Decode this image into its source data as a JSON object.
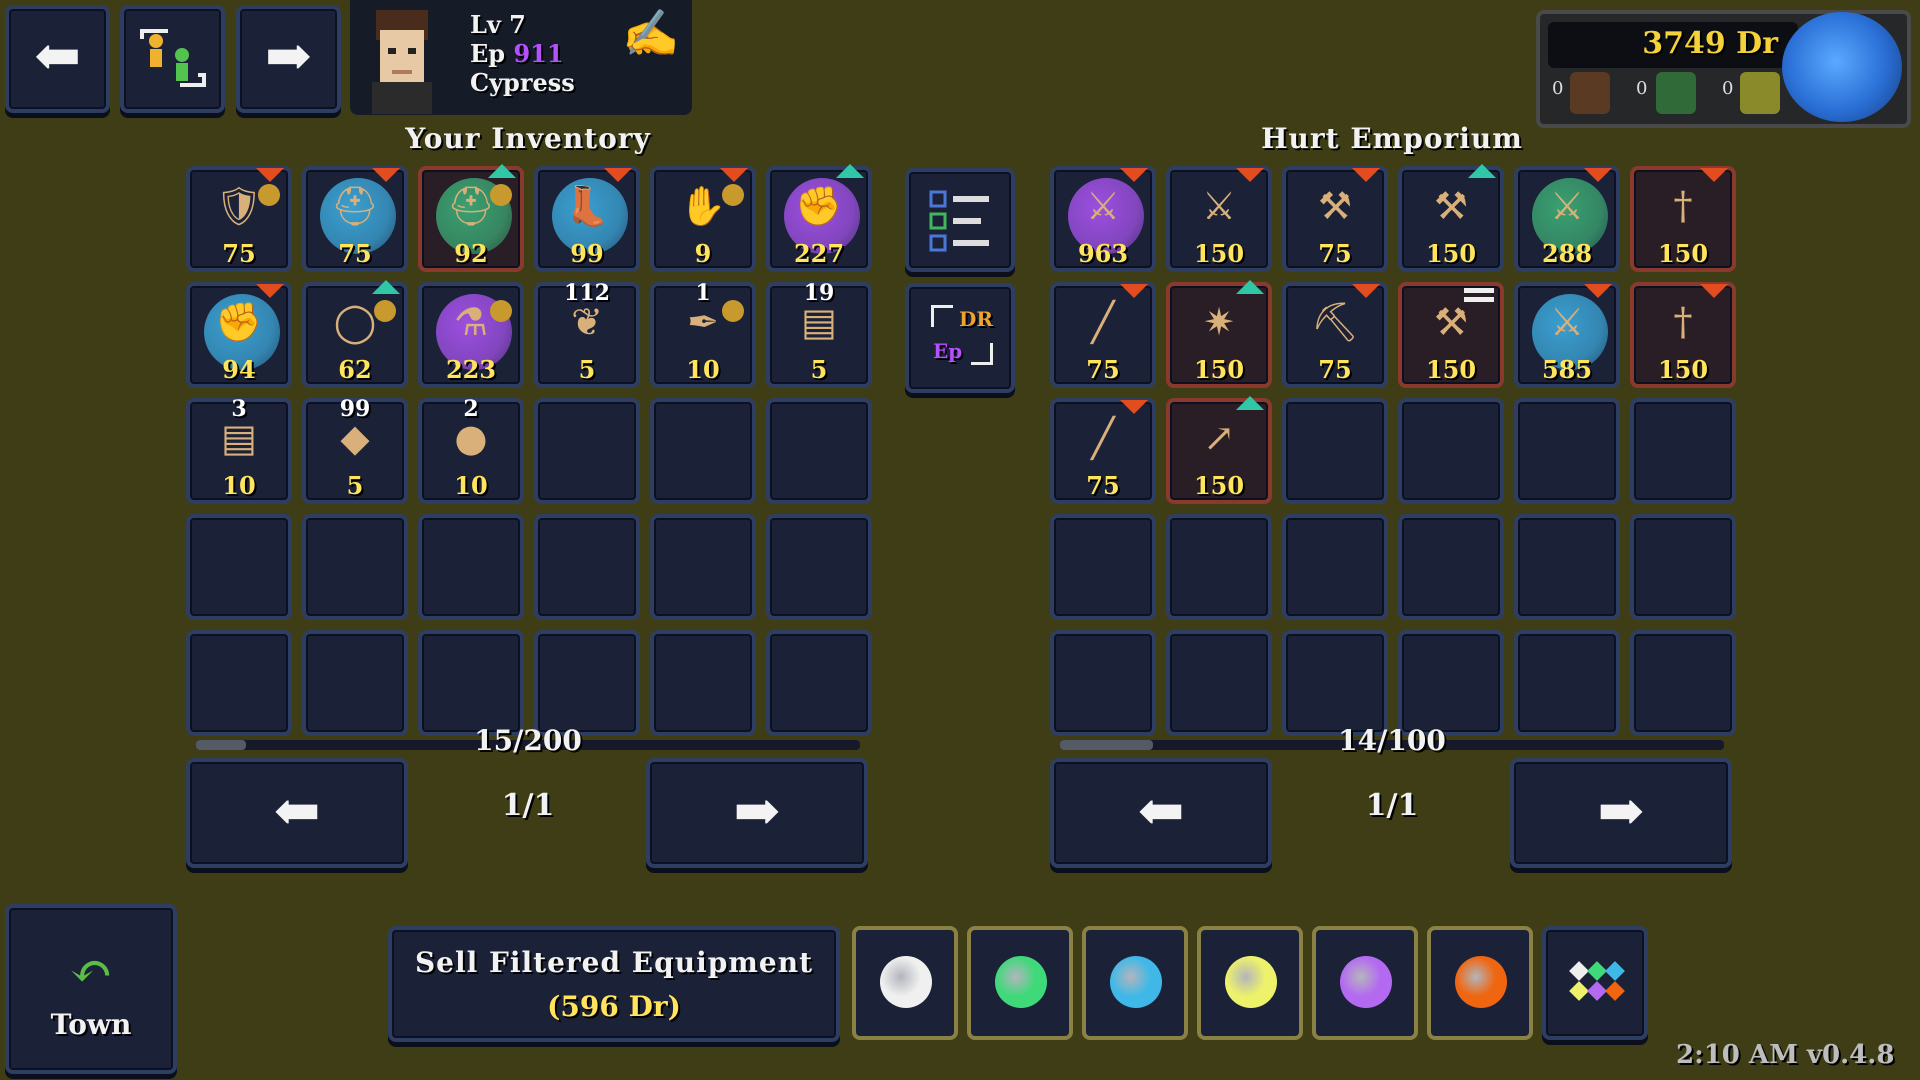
{
  "nav": {
    "prev_icon": "arrow-left",
    "party_icon": "swap-party",
    "next_icon": "arrow-right"
  },
  "character": {
    "level": "Lv 7",
    "ep_label": "Ep",
    "ep_value": "911",
    "name": "Cypress"
  },
  "currency": {
    "dr": "3749 Dr",
    "res1": "0",
    "res2": "0",
    "res3": "0"
  },
  "inventory": {
    "title": "Your Inventory",
    "count": "15/200",
    "fill": 0.075,
    "page": "1/1",
    "items": [
      {
        "icon": "goblin-armor",
        "orb": "",
        "price": "75",
        "qty": "",
        "mark": "down",
        "dot": true
      },
      {
        "icon": "hat",
        "orb": "#3a9fd0",
        "price": "75",
        "qty": "",
        "mark": "down",
        "dot": false
      },
      {
        "icon": "helmet",
        "orb": "#3aa070",
        "price": "92",
        "qty": "",
        "mark": "up",
        "dot": true,
        "red": true
      },
      {
        "icon": "boots",
        "orb": "#3a9fd0",
        "price": "99",
        "qty": "",
        "mark": "down",
        "dot": false
      },
      {
        "icon": "blue-glove",
        "orb": "",
        "price": "9",
        "qty": "",
        "mark": "down",
        "dot": true
      },
      {
        "icon": "gauntlet",
        "orb": "#9c4fe0",
        "price": "227",
        "qty": "",
        "mark": "up",
        "dot": false
      },
      {
        "icon": "glove",
        "orb": "#3a9fd0",
        "price": "94",
        "qty": "",
        "mark": "down",
        "dot": false
      },
      {
        "icon": "ring",
        "orb": "",
        "price": "62",
        "qty": "",
        "mark": "up",
        "dot": true
      },
      {
        "icon": "potion",
        "orb": "#9c4fe0",
        "price": "223",
        "qty": "",
        "mark": "",
        "dot": true
      },
      {
        "icon": "leaf",
        "orb": "",
        "price": "5",
        "qty": "112",
        "mark": "",
        "dot": false
      },
      {
        "icon": "feather",
        "orb": "",
        "price": "10",
        "qty": "1",
        "mark": "",
        "dot": true
      },
      {
        "icon": "leather",
        "orb": "",
        "price": "5",
        "qty": "19",
        "mark": "",
        "dot": false
      },
      {
        "icon": "hide",
        "orb": "",
        "price": "10",
        "qty": "3",
        "mark": "",
        "dot": false
      },
      {
        "icon": "ore",
        "orb": "",
        "price": "5",
        "qty": "99",
        "mark": "",
        "dot": false
      },
      {
        "icon": "stone",
        "orb": "",
        "price": "10",
        "qty": "2",
        "mark": "",
        "dot": false
      }
    ]
  },
  "shop": {
    "title": "Hurt Emporium",
    "count": "14/100",
    "fill": 0.14,
    "page": "1/1",
    "items": [
      {
        "icon": "sword-gold",
        "orb": "#9c4fe0",
        "price": "963",
        "mark": "down",
        "red": false
      },
      {
        "icon": "sword",
        "orb": "",
        "price": "150",
        "mark": "down",
        "red": false
      },
      {
        "icon": "axe",
        "orb": "",
        "price": "75",
        "mark": "down",
        "red": false
      },
      {
        "icon": "axe-silver",
        "orb": "",
        "price": "150",
        "mark": "up",
        "red": false
      },
      {
        "icon": "sword-green",
        "orb": "#3aa070",
        "price": "288",
        "mark": "down",
        "red": false
      },
      {
        "icon": "dagger",
        "orb": "",
        "price": "150",
        "mark": "down",
        "red": true
      },
      {
        "icon": "club",
        "orb": "",
        "price": "75",
        "mark": "down",
        "red": false
      },
      {
        "icon": "mace",
        "orb": "",
        "price": "150",
        "mark": "up",
        "red": true
      },
      {
        "icon": "pick",
        "orb": "",
        "price": "75",
        "mark": "down",
        "red": false
      },
      {
        "icon": "hammer",
        "orb": "",
        "price": "150",
        "mark": "eq",
        "red": true
      },
      {
        "icon": "sword-blue",
        "orb": "#3a9fd0",
        "price": "585",
        "mark": "down",
        "red": false
      },
      {
        "icon": "knife",
        "orb": "",
        "price": "150",
        "mark": "down",
        "red": true
      },
      {
        "icon": "staff",
        "orb": "",
        "price": "75",
        "mark": "down",
        "red": false
      },
      {
        "icon": "spear",
        "orb": "",
        "price": "150",
        "mark": "up",
        "red": true
      }
    ]
  },
  "sidebar": {
    "filter_icon": "filter-list",
    "convert_label_top": "DR",
    "convert_label_bottom": "Ep"
  },
  "bottom": {
    "town_label": "Town",
    "sell_label": "Sell Filtered Equipment",
    "sell_value": "(596 Dr)",
    "swatches": [
      "#f0f0f0",
      "#3fd97a",
      "#3fb8e8",
      "#eef26a",
      "#b46af0",
      "#f0650f"
    ],
    "version": "2:10 AM v0.4.8"
  },
  "colors": {
    "background": "#3f3d16",
    "price": "#ffe45c",
    "ep": "#b350ff",
    "currency": "#f5d23a"
  }
}
